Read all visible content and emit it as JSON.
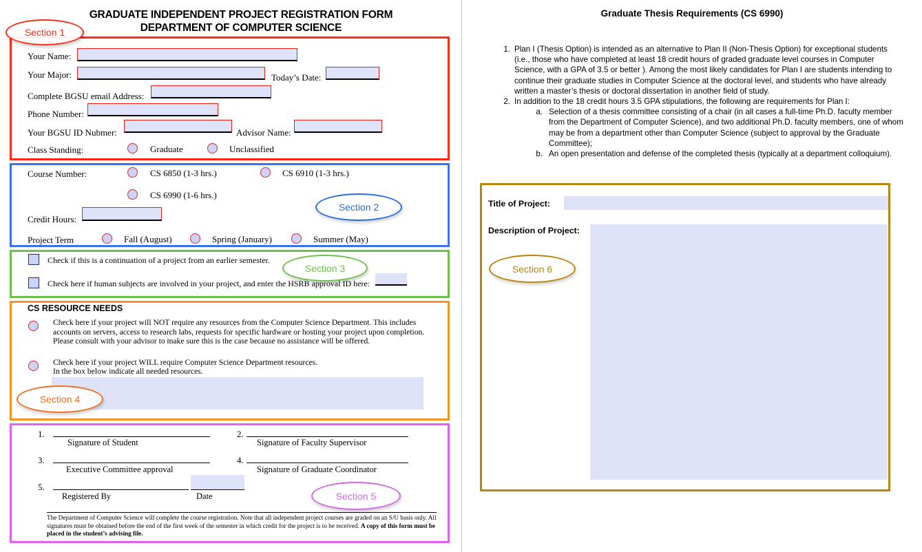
{
  "left_page": {
    "title_line1": "GRADUATE INDEPENDENT PROJECT REGISTRATION FORM",
    "title_line2": "DEPARTMENT OF COMPUTER SCIENCE",
    "section1": {
      "tag": "Section 1",
      "fields": {
        "your_name_label": "Your Name:",
        "your_name_value": "",
        "your_major_label": "Your Major:",
        "your_major_value": "",
        "todays_date_label": "Today’s Date:",
        "todays_date_value": "",
        "email_label": "Complete BGSU email Address:",
        "email_value": "",
        "phone_label": "Phone Number:",
        "phone_value": "",
        "bgsu_id_label": "Your BGSU ID Nubmer:",
        "bgsu_id_value": "",
        "advisor_label": "Advisor Name:",
        "advisor_value": "",
        "class_standing_label": "Class Standing:",
        "class_standing_options": [
          "Graduate",
          "Unclassified"
        ]
      }
    },
    "section2": {
      "tag": "Section 2",
      "course_number_label": "Course Number:",
      "course_options": [
        "CS 6850 (1-3 hrs.)",
        "CS 6910 (1-3 hrs.)",
        "CS 6990 (1-6 hrs.)"
      ],
      "credit_hours_label": "Credit Hours:",
      "credit_hours_value": "",
      "project_term_label": "Project Term",
      "term_options": [
        "Fall (August)",
        "Spring (January)",
        "Summer (May)"
      ]
    },
    "section3": {
      "tag": "Section 3",
      "continuation_text": "Check if this is a continuation of a project from an earlier semester.",
      "human_subjects_text": "Check here if human subjects are involved in your project, and enter the HSRB approval ID here:",
      "hsrb_value": ""
    },
    "section4": {
      "tag": "Section 4",
      "heading": "CS RESOURCE NEEDS",
      "option_no_resources": "Check here if your project will NOT require any resources from the Computer Science Department. This includes accounts on servers, access to research labs, requests for specific hardware or hosting your project upon completion. Please consult with your advisor to make sure this is the case because no assistance will be offered.",
      "option_will_require_line1": "Check here if your project WILL require Computer Science Department resources.",
      "option_will_require_line2": "In the box below indicate all needed resources.",
      "resources_box_value": ""
    },
    "section5": {
      "tag": "Section 5",
      "signatures": [
        {
          "number": "1.",
          "caption": "Signature of Student"
        },
        {
          "number": "2.",
          "caption": "Signature of Faculty Supervisor"
        },
        {
          "number": "3.",
          "caption": "Executive Committee approval"
        },
        {
          "number": "4.",
          "caption": "Signature of Graduate Coordinator"
        },
        {
          "number": "5.",
          "caption": "Registered By"
        }
      ],
      "date_caption": "Date",
      "date_value": "",
      "disclaimer_part1": "The Department of Computer Science will complete the course registration. Note that all independent project courses are graded on an S/U basis only. All signatures must be obtained before the end of the first week of the semester in which credit for the project is to be received. ",
      "disclaimer_part2": "A copy of this form must be placed in the student’s advising file."
    }
  },
  "right_page": {
    "title": "Graduate Thesis Requirements (CS 6990)",
    "requirements": [
      {
        "mark": "1.",
        "text": "Plan I (Thesis Option) is intended as an alternative to Plan II (Non-Thesis Option) for exceptional students (i.e., those who have completed at least 18 credit hours of graded graduate level courses in Computer Science, with a GPA of 3.5 or better ). Among the most likely candidates for Plan I are students intending to continue their graduate studies in Computer Science at the doctoral level, and students who have already written a master’s thesis or doctoral dissertation in another field of study."
      },
      {
        "mark": "2.",
        "text": "In addition to the 18 credit hours 3.5 GPA stipulations, the following are requirements for Plan I:",
        "subitems": [
          {
            "mark": "a.",
            "text": "Selection of a thesis committee consisting of a chair (in all cases a full-time Ph.D. faculty member from the Department of Computer Science), and two additional Ph.D. faculty members, one of whom may be from a department other than Computer Science (subject to approval by the Graduate Committee);"
          },
          {
            "mark": "b.",
            "text": "An open presentation and defense of the completed thesis (typically at a department colloquium)."
          }
        ]
      }
    ],
    "section6": {
      "tag": "Section 6",
      "title_of_project_label": "Title of Project:",
      "title_of_project_value": "",
      "description_of_project_label": "Description of Project:",
      "description_of_project_value": ""
    }
  },
  "colors": {
    "section1_accent": "#fe2b12",
    "section2_accent": "#3a6ff0",
    "section3_accent": "#6cc04a",
    "section4_accent": "#f79420",
    "section5_accent": "#e35ff0",
    "section6_accent": "#b8860b",
    "field_fill": "#dfe3fa",
    "field_border": "#ee1c17",
    "checkbox_border": "#1b2f6e"
  }
}
